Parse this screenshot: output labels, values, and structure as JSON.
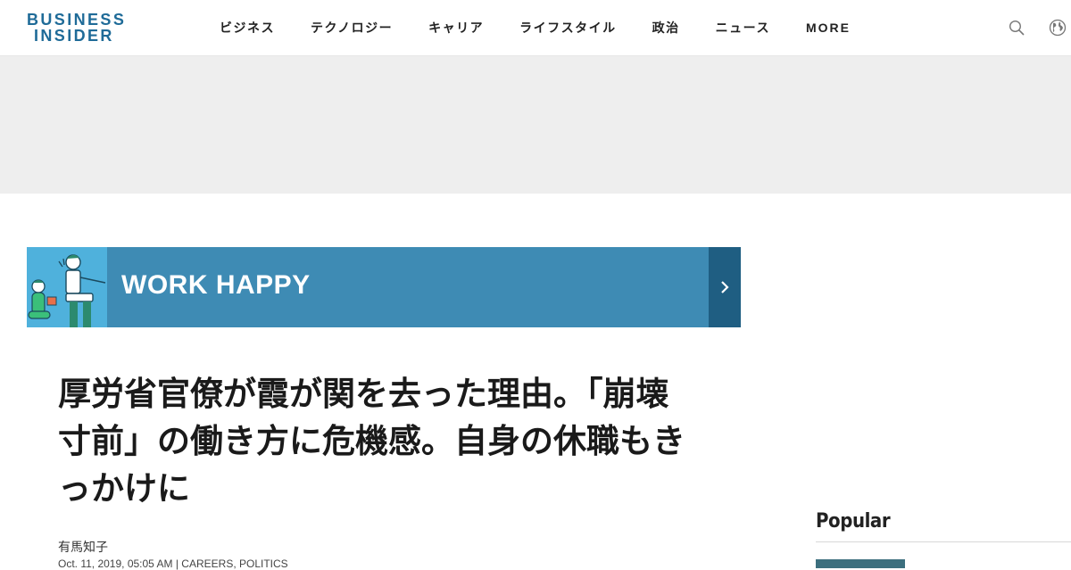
{
  "header": {
    "logo_line1": "BUSINESS",
    "logo_line2": "INSIDER",
    "nav": [
      "ビジネス",
      "テクノロジー",
      "キャリア",
      "ライフスタイル",
      "政治",
      "ニュース",
      "MORE"
    ],
    "icons": {
      "search": "search-icon",
      "language": "globe-icon"
    }
  },
  "banner": {
    "title": "WORK HAPPY",
    "arrow_icon": "chevron-right-icon"
  },
  "article": {
    "headline": "厚労省官僚が霞が関を去った理由。「崩壊寸前」の働き方に危機感。自身の休職もきっかけに",
    "author": "有馬知子",
    "meta": "Oct. 11, 2019, 05:05 AM | CAREERS, POLITICS"
  },
  "sidebar": {
    "popular_title": "Popular"
  },
  "colors": {
    "brand": "#1f6b98",
    "banner_bg": "#3e8bb4",
    "banner_dark": "#1f5e82",
    "banner_illustration": "#4fb1dc",
    "ad_band": "#eeeeee"
  }
}
